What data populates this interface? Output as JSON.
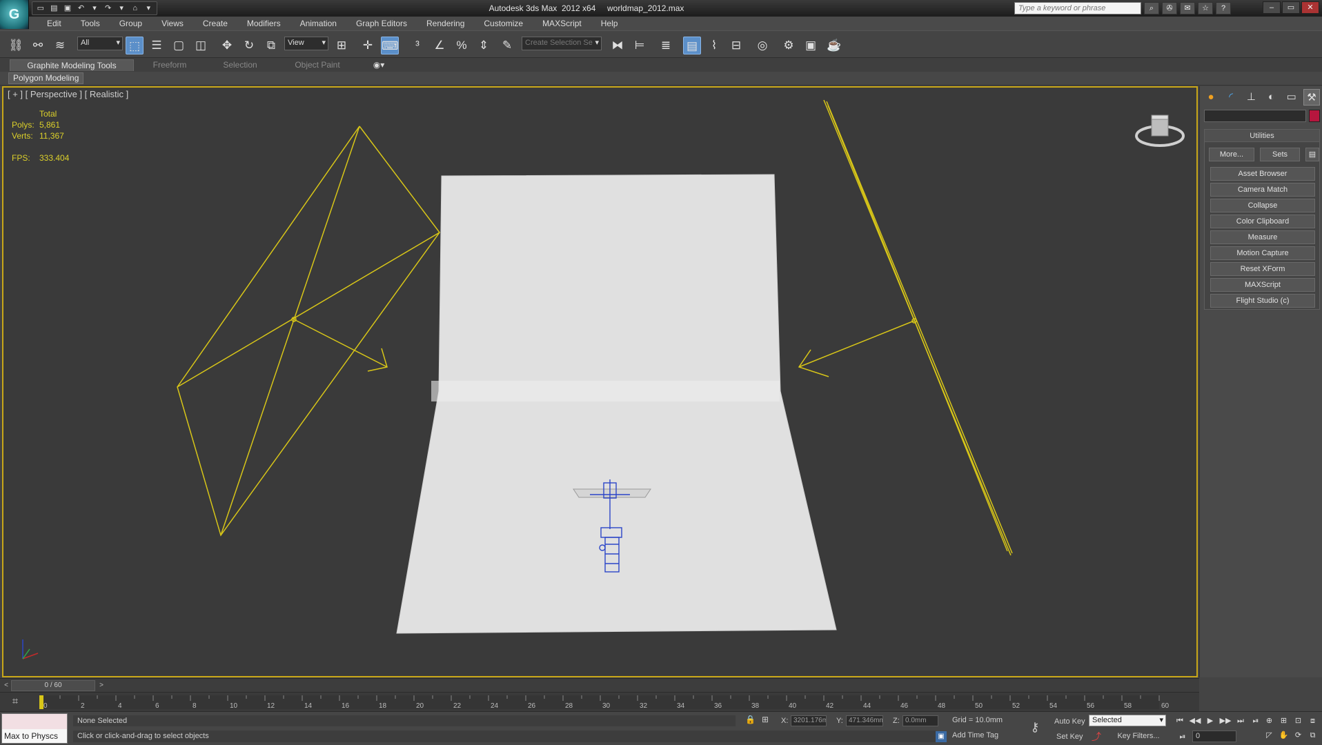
{
  "app": {
    "logo": "G",
    "title": "Autodesk 3ds Max  2012 x64     worldmap_2012.max",
    "search_placeholder": "Type a keyword or phrase"
  },
  "menu": [
    "Edit",
    "Tools",
    "Group",
    "Views",
    "Create",
    "Modifiers",
    "Animation",
    "Graph Editors",
    "Rendering",
    "Customize",
    "MAXScript",
    "Help"
  ],
  "toolbar": {
    "filter_value": "All",
    "coord_system_value": "View",
    "named_selection_placeholder": "Create Selection Se"
  },
  "ribbon": {
    "tabs": [
      "Graphite Modeling Tools",
      "Freeform",
      "Selection",
      "Object Paint"
    ],
    "panel_label": "Polygon Modeling"
  },
  "viewport": {
    "label": "[ + ] [ Perspective ] [ Realistic ]",
    "stats": {
      "total_label": "Total",
      "polys_label": "Polys:",
      "polys_value": "5,861",
      "verts_label": "Verts:",
      "verts_value": "11,367",
      "fps_label": "FPS:",
      "fps_value": "333.404"
    },
    "colors": {
      "border": "#c9a718",
      "wire": "#d8c618",
      "backdrop": "#e2e2e2",
      "helicopter": "#2b45c8"
    }
  },
  "command_panel": {
    "rollout_title": "Utilities",
    "more_label": "More...",
    "sets_label": "Sets",
    "buttons": [
      "Asset Browser",
      "Camera Match",
      "Collapse",
      "Color Clipboard",
      "Measure",
      "Motion Capture",
      "Reset XForm",
      "MAXScript",
      "Flight Studio (c)"
    ]
  },
  "timeline": {
    "slider_label": "0 / 60",
    "ticks": [
      "0",
      "2",
      "4",
      "6",
      "8",
      "10",
      "12",
      "14",
      "16",
      "18",
      "20",
      "22",
      "24",
      "26",
      "28",
      "30",
      "32",
      "34",
      "36",
      "38",
      "40",
      "42",
      "44",
      "46",
      "48",
      "50",
      "52",
      "54",
      "56",
      "58",
      "60"
    ]
  },
  "status": {
    "listener_label": "Max to Physcs",
    "selection": "None Selected",
    "prompt": "Click or click-and-drag to select objects",
    "x_label": "X:",
    "x_value": "3201.176m",
    "y_label": "Y:",
    "y_value": "471.346mm",
    "z_label": "Z:",
    "z_value": "0.0mm",
    "grid": "Grid = 10.0mm",
    "add_time_tag": "Add Time Tag",
    "auto_key": "Auto Key",
    "selected_value": "Selected",
    "set_key": "Set Key",
    "key_filters": "Key Filters...",
    "frame_value": "0"
  }
}
